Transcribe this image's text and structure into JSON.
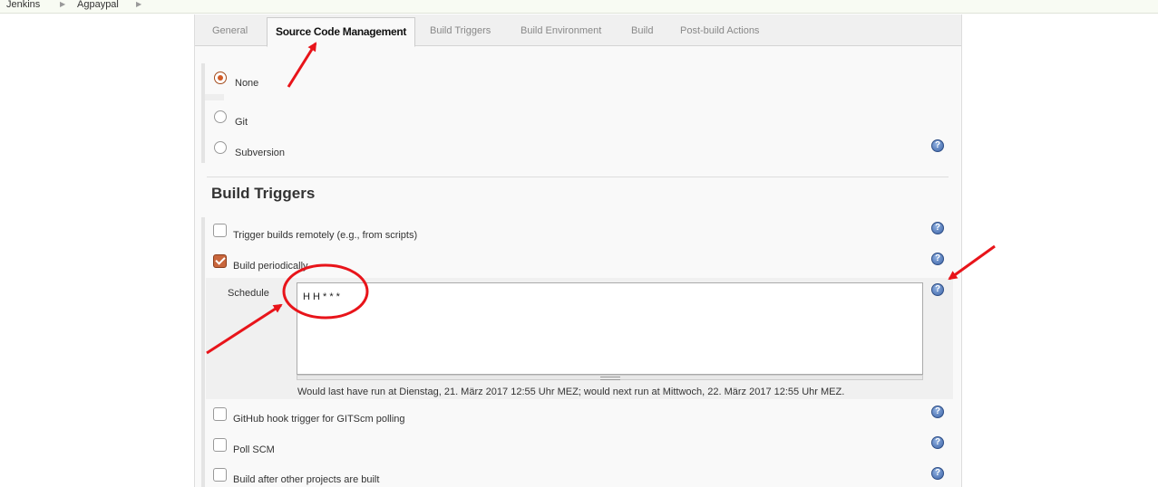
{
  "breadcrumb": {
    "items": [
      "Jenkins",
      "Agpaypal"
    ]
  },
  "tabs": [
    "General",
    "Source Code Management",
    "Build Triggers",
    "Build Environment",
    "Build",
    "Post-build Actions"
  ],
  "active_tab": "Source Code Management",
  "scm": {
    "options": [
      {
        "label": "None",
        "checked": true
      },
      {
        "label": "Git",
        "checked": false
      },
      {
        "label": "Subversion",
        "checked": false
      }
    ]
  },
  "build_triggers": {
    "heading": "Build Triggers",
    "options": [
      {
        "label": "Trigger builds remotely (e.g., from scripts)",
        "checked": false
      },
      {
        "label": "Build periodically",
        "checked": true
      },
      {
        "label": "GitHub hook trigger for GITScm polling",
        "checked": false
      },
      {
        "label": "Poll SCM",
        "checked": false
      },
      {
        "label": "Build after other projects are built",
        "checked": false
      }
    ],
    "schedule_label": "Schedule",
    "schedule_value": "H H * * *",
    "schedule_info": "Would last have run at Dienstag, 21. März 2017 12:55 Uhr MEZ; would next run at Mittwoch, 22. März 2017 12:55 Uhr MEZ."
  },
  "help_icon": "question-mark-icon",
  "colors": {
    "annotation": "#e8141a",
    "checkbox_checked": "#c9663c",
    "radio_checked": "#d25b26"
  }
}
